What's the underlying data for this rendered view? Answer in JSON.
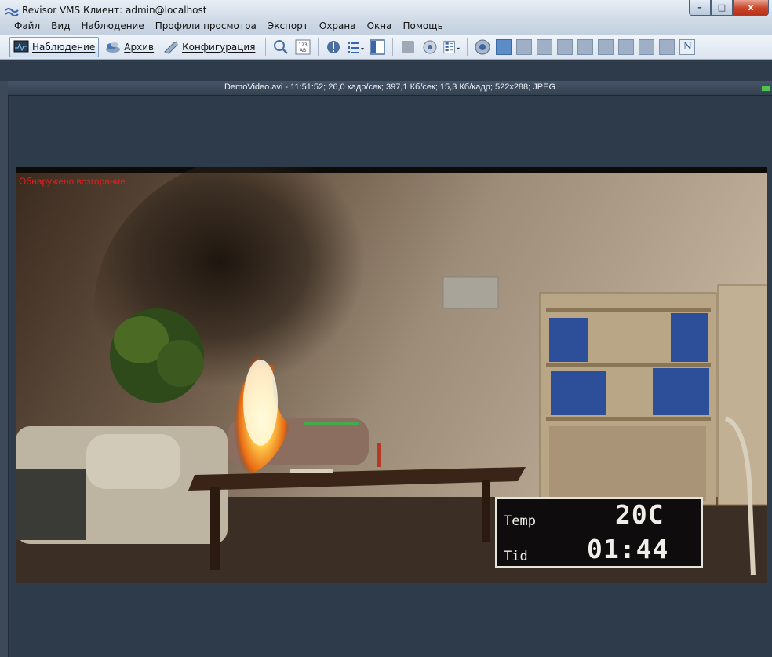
{
  "window": {
    "title": "Revisor VMS Клиент: admin@localhost",
    "minimize": "–",
    "maximize": "□",
    "close": "x"
  },
  "menu": [
    "Файл",
    "Вид",
    "Наблюдение",
    "Профили просмотра",
    "Экспорт",
    "Охрана",
    "Окна",
    "Помощь"
  ],
  "toolbar": {
    "modes": [
      {
        "label": "Наблюдение",
        "icon": "monitor-icon",
        "active": true
      },
      {
        "label": "Архив",
        "icon": "archive-icon",
        "active": false
      },
      {
        "label": "Конфигурация",
        "icon": "config-wrench-icon",
        "active": false
      }
    ],
    "tools": [
      "search-icon",
      "numbering-icon",
      "alert-icon",
      "list-icon",
      "panel-icon",
      "disabled-icon",
      "disk-icon",
      "layout-menu-icon",
      "camera-icon"
    ],
    "numbering_text": "123",
    "n_button": "N"
  },
  "channel": {
    "info": "DemoVideo.avi - 11:51:52; 26,0 кадр/сек; 397,1 Кб/сек; 15,3 Кб/кадр; 522x288; JPEG"
  },
  "video": {
    "alarm_text": "Обнаружено возгорание",
    "osd": {
      "temp_label": "Temp",
      "temp_value": "20C",
      "time_label": "Tid",
      "time_value": "01:44"
    }
  },
  "colors": {
    "alarm": "#e81c1c",
    "background": "#2e3b4b",
    "status": "#4ec44e"
  }
}
